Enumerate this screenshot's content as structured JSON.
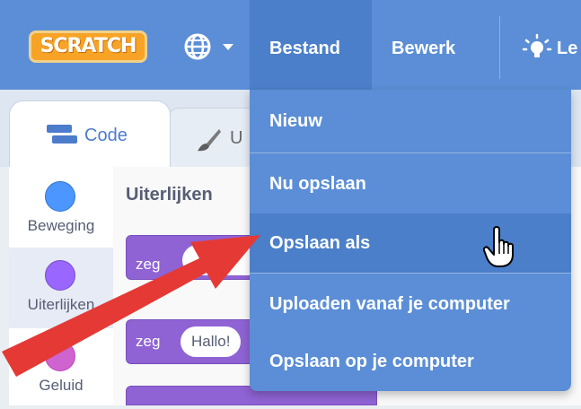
{
  "menubar": {
    "logo_text": "SCRATCH",
    "file_label": "Bestand",
    "edit_label": "Bewerk",
    "tutorials_label": "Le",
    "icons": {
      "language": "globe-icon",
      "tutorials": "lightbulb-icon"
    }
  },
  "tabs": {
    "code_label": "Code",
    "costumes_label": "U"
  },
  "categories": [
    {
      "label": "Beweging",
      "color": "#4c97ff"
    },
    {
      "label": "Uiterlijken",
      "color": "#9966ff"
    },
    {
      "label": "Geluid",
      "color": "#cf63cf"
    }
  ],
  "palette": {
    "title": "Uiterlijken",
    "blocks": [
      {
        "label": "zeg",
        "input": ""
      },
      {
        "label": "zeg",
        "input": "Hallo!"
      }
    ]
  },
  "file_menu": {
    "items": [
      {
        "label": "Nieuw"
      },
      {
        "label": "Nu opslaan"
      },
      {
        "label": "Opslaan als"
      },
      {
        "label": "Uploaden vanaf je computer"
      },
      {
        "label": "Opslaan op je computer"
      }
    ],
    "hovered_index": 2
  },
  "colors": {
    "menubar": "#5b8ed6",
    "menu_active": "#4b7fc9",
    "annotation_arrow": "#e53935",
    "looks_block": "#8f63d4"
  }
}
